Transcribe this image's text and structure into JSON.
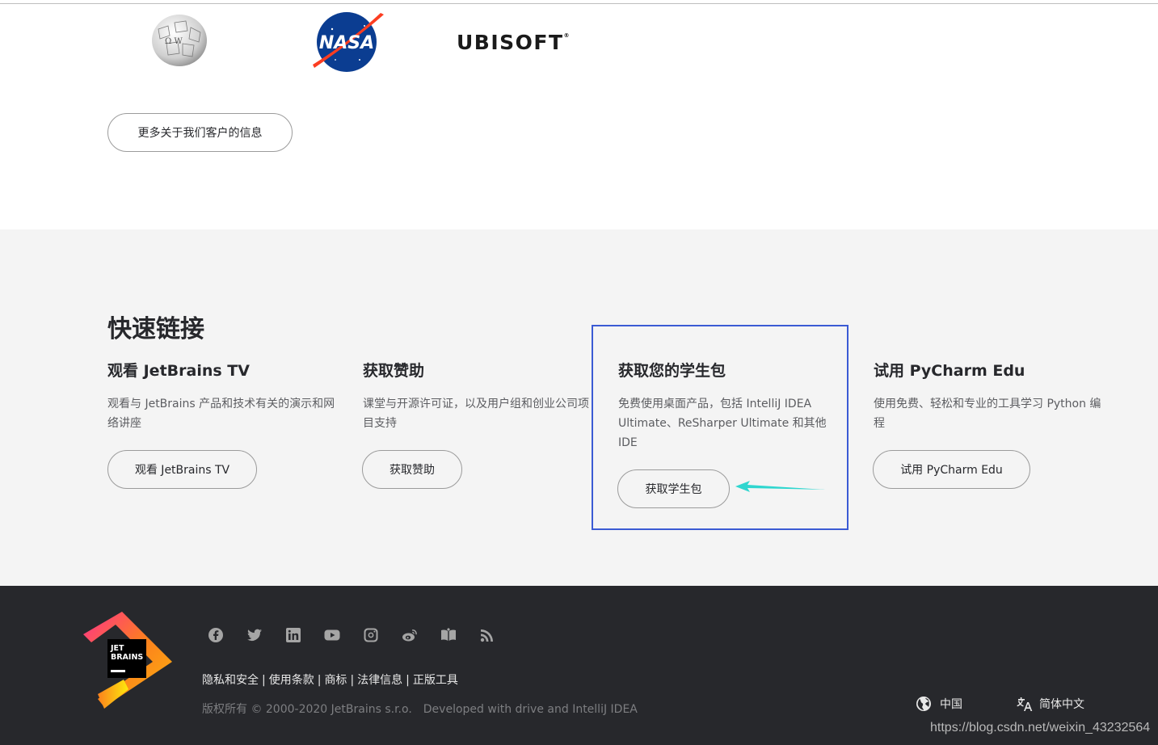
{
  "customers": {
    "logos": [
      {
        "name": "wikipedia-logo",
        "text": "Ω W"
      },
      {
        "name": "nasa-logo",
        "text": "NASA"
      },
      {
        "name": "ubisoft-logo",
        "text": "UBISOFT"
      }
    ],
    "more_button": "更多关于我们客户的信息"
  },
  "quick_links": {
    "title": "快速链接",
    "items": [
      {
        "title": "观看 JetBrains TV",
        "desc": "观看与 JetBrains 产品和技术有关的演示和网络讲座",
        "button": "观看 JetBrains TV"
      },
      {
        "title": "获取赞助",
        "desc": "课堂与开源许可证，以及用户组和创业公司项目支持",
        "button": "获取赞助"
      },
      {
        "title": "获取您的学生包",
        "desc": "免费使用桌面产品，包括 IntelliJ IDEA Ultimate、ReSharper Ultimate 和其他 IDE",
        "button": "获取学生包"
      },
      {
        "title": "试用 PyCharm Edu",
        "desc": "使用免费、轻松和专业的工具学习 Python 编程",
        "button": "试用 PyCharm Edu"
      }
    ]
  },
  "footer": {
    "logo_text": [
      "JET",
      "BRAINS"
    ],
    "social_icons": [
      "facebook-icon",
      "twitter-icon",
      "linkedin-icon",
      "youtube-icon",
      "instagram-icon",
      "weibo-icon",
      "book-icon",
      "rss-icon"
    ],
    "links": [
      "隐私和安全",
      "使用条款",
      "商标",
      "法律信息",
      "正版工具"
    ],
    "copyright": "版权所有 © 2000-2020 JetBrains s.r.o.",
    "developed": "Developed with drive and IntelliJ IDEA",
    "region": "中国",
    "language": "简体中文"
  },
  "watermark": "https://blog.csdn.net/weixin_43232564",
  "colors": {
    "highlight_border": "#3b5bd4",
    "arrow": "#2fd6cf",
    "footer_bg": "#27282c",
    "section_bg": "#f4f4f4"
  }
}
